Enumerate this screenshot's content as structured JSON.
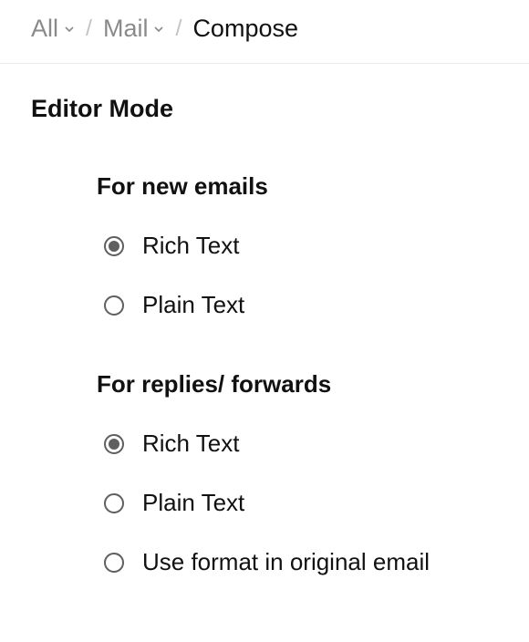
{
  "breadcrumb": {
    "items": [
      {
        "label": "All",
        "hasDropdown": true,
        "current": false
      },
      {
        "label": "Mail",
        "hasDropdown": true,
        "current": false
      },
      {
        "label": "Compose",
        "hasDropdown": false,
        "current": true
      }
    ]
  },
  "section": {
    "title": "Editor Mode",
    "groups": [
      {
        "title": "For new emails",
        "options": [
          {
            "label": "Rich Text",
            "selected": true
          },
          {
            "label": "Plain Text",
            "selected": false
          }
        ]
      },
      {
        "title": "For replies/ forwards",
        "options": [
          {
            "label": "Rich Text",
            "selected": true
          },
          {
            "label": "Plain Text",
            "selected": false
          },
          {
            "label": "Use format in original email",
            "selected": false
          }
        ]
      }
    ]
  }
}
